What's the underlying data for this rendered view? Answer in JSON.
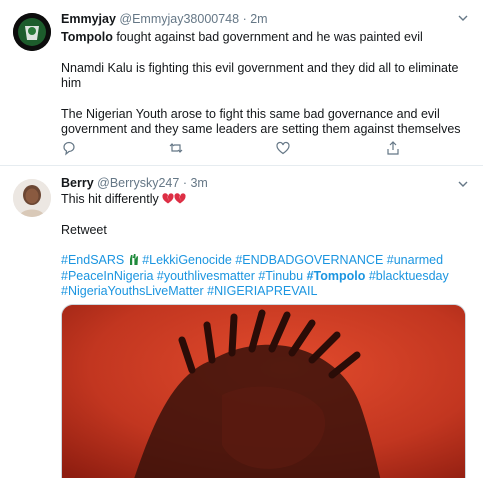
{
  "tweets": [
    {
      "display_name": "Emmyjay",
      "handle": "@Emmyjay38000748",
      "separator": "·",
      "time": "2m",
      "line1_bold": "Tompolo",
      "line1_rest": " fought against bad government and he was painted evil",
      "para2": "Nnamdi Kalu is fighting this evil government and they did all to eliminate him",
      "para3": "The Nigerian Youth arose to fight this same bad governance and evil government and they same leaders are setting them against themselves",
      "actions": [
        "reply-icon",
        "retweet-icon",
        "like-icon",
        "share-icon"
      ]
    },
    {
      "display_name": "Berry",
      "handle": "@Berrysky247",
      "separator": "·",
      "time": "3m",
      "line1": "This hit differently",
      "para2": "Retweet",
      "hashtags": [
        "#EndSARS",
        "#LekkiGenocide",
        "#ENDBADGOVERNANCE",
        "#unarmed",
        "#PeaceInNigeria",
        "#youthlivesmatter",
        "#Tinubu",
        "#Tompolo",
        "#blacktuesday",
        "#NigeriaYouthsLiveMatter",
        "#NIGERIAPREVAIL"
      ]
    }
  ],
  "colors": {
    "link": "#1b95e0",
    "muted": "#657786",
    "text": "#14171a",
    "border": "#e6ecf0"
  }
}
